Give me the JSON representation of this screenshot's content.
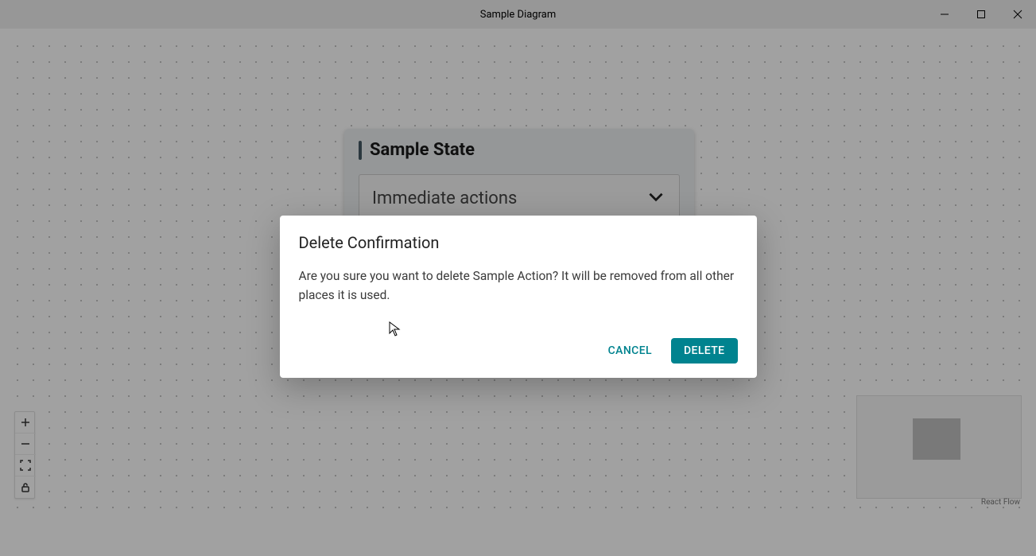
{
  "window": {
    "title": "Sample Diagram"
  },
  "state": {
    "title": "Sample State",
    "section_label": "Immediate actions"
  },
  "dialog": {
    "title": "Delete Confirmation",
    "body": "Are you sure you want to delete Sample Action? It will be removed from all other places it is used.",
    "cancel_label": "Cancel",
    "delete_label": "Delete"
  },
  "attribution": "React Flow"
}
